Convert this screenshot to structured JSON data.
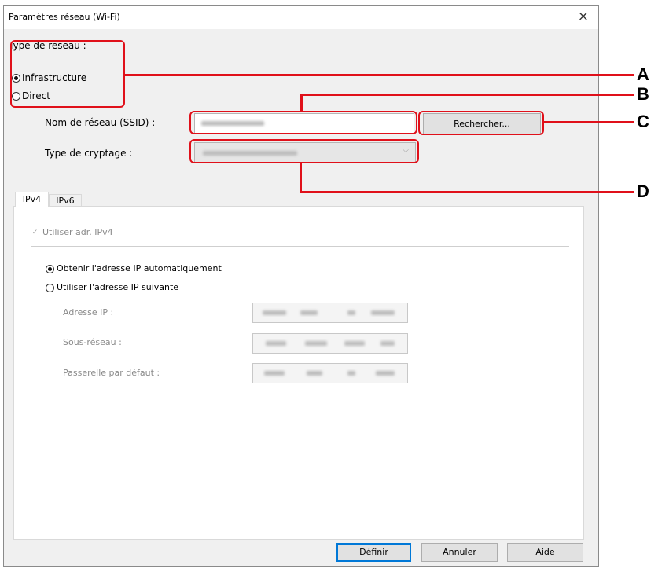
{
  "window": {
    "title": "Paramètres réseau (Wi-Fi)",
    "close_glyph": "×"
  },
  "network_type": {
    "label": "Type de réseau :",
    "options": [
      {
        "label": "Infrastructure",
        "selected": true
      },
      {
        "label": "Direct",
        "selected": false
      }
    ]
  },
  "ssid": {
    "label": "Nom de réseau (SSID) :",
    "search_button": "Rechercher..."
  },
  "encryption": {
    "label": "Type de cryptage :",
    "chevron": "⌵"
  },
  "tabs": [
    "IPv4",
    "IPv6"
  ],
  "ipv4": {
    "use_checkbox": "Utiliser adr. IPv4",
    "use_checked": true,
    "auto_option": "Obtenir l'adresse IP automatiquement",
    "manual_option": "Utiliser l'adresse IP suivante",
    "ip_label": "Adresse IP :",
    "subnet_label": "Sous-réseau :",
    "gateway_label": "Passerelle par défaut :"
  },
  "buttons": {
    "ok": "Définir",
    "cancel": "Annuler",
    "help": "Aide"
  },
  "callouts": {
    "a": "A",
    "b": "B",
    "c": "C",
    "d": "D"
  },
  "colors": {
    "annotation_red": "#e0101a",
    "dialog_bg": "#f0f0f0"
  }
}
